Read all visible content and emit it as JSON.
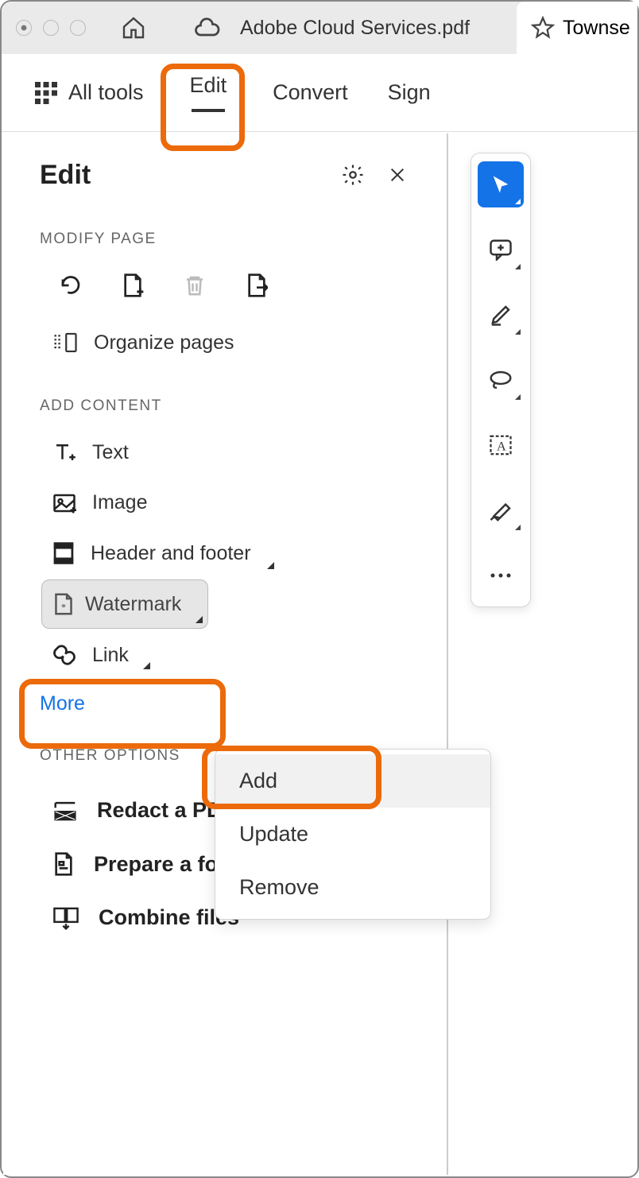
{
  "titlebar": {
    "filename": "Adobe Cloud Services.pdf",
    "tab2": "Townse"
  },
  "toolbar": {
    "all_tools": "All tools",
    "edit": "Edit",
    "convert": "Convert",
    "sign": "Sign"
  },
  "panel": {
    "title": "Edit",
    "section_modify": "MODIFY PAGE",
    "organize": "Organize pages",
    "section_add": "ADD CONTENT",
    "text": "Text",
    "image": "Image",
    "header_footer": "Header and footer",
    "watermark": "Watermark",
    "link": "Link",
    "more": "More",
    "section_other": "OTHER OPTIONS",
    "redact": "Redact a PDF",
    "prepare": "Prepare a form",
    "combine": "Combine files"
  },
  "popup": {
    "add": "Add",
    "update": "Update",
    "remove": "Remove"
  }
}
